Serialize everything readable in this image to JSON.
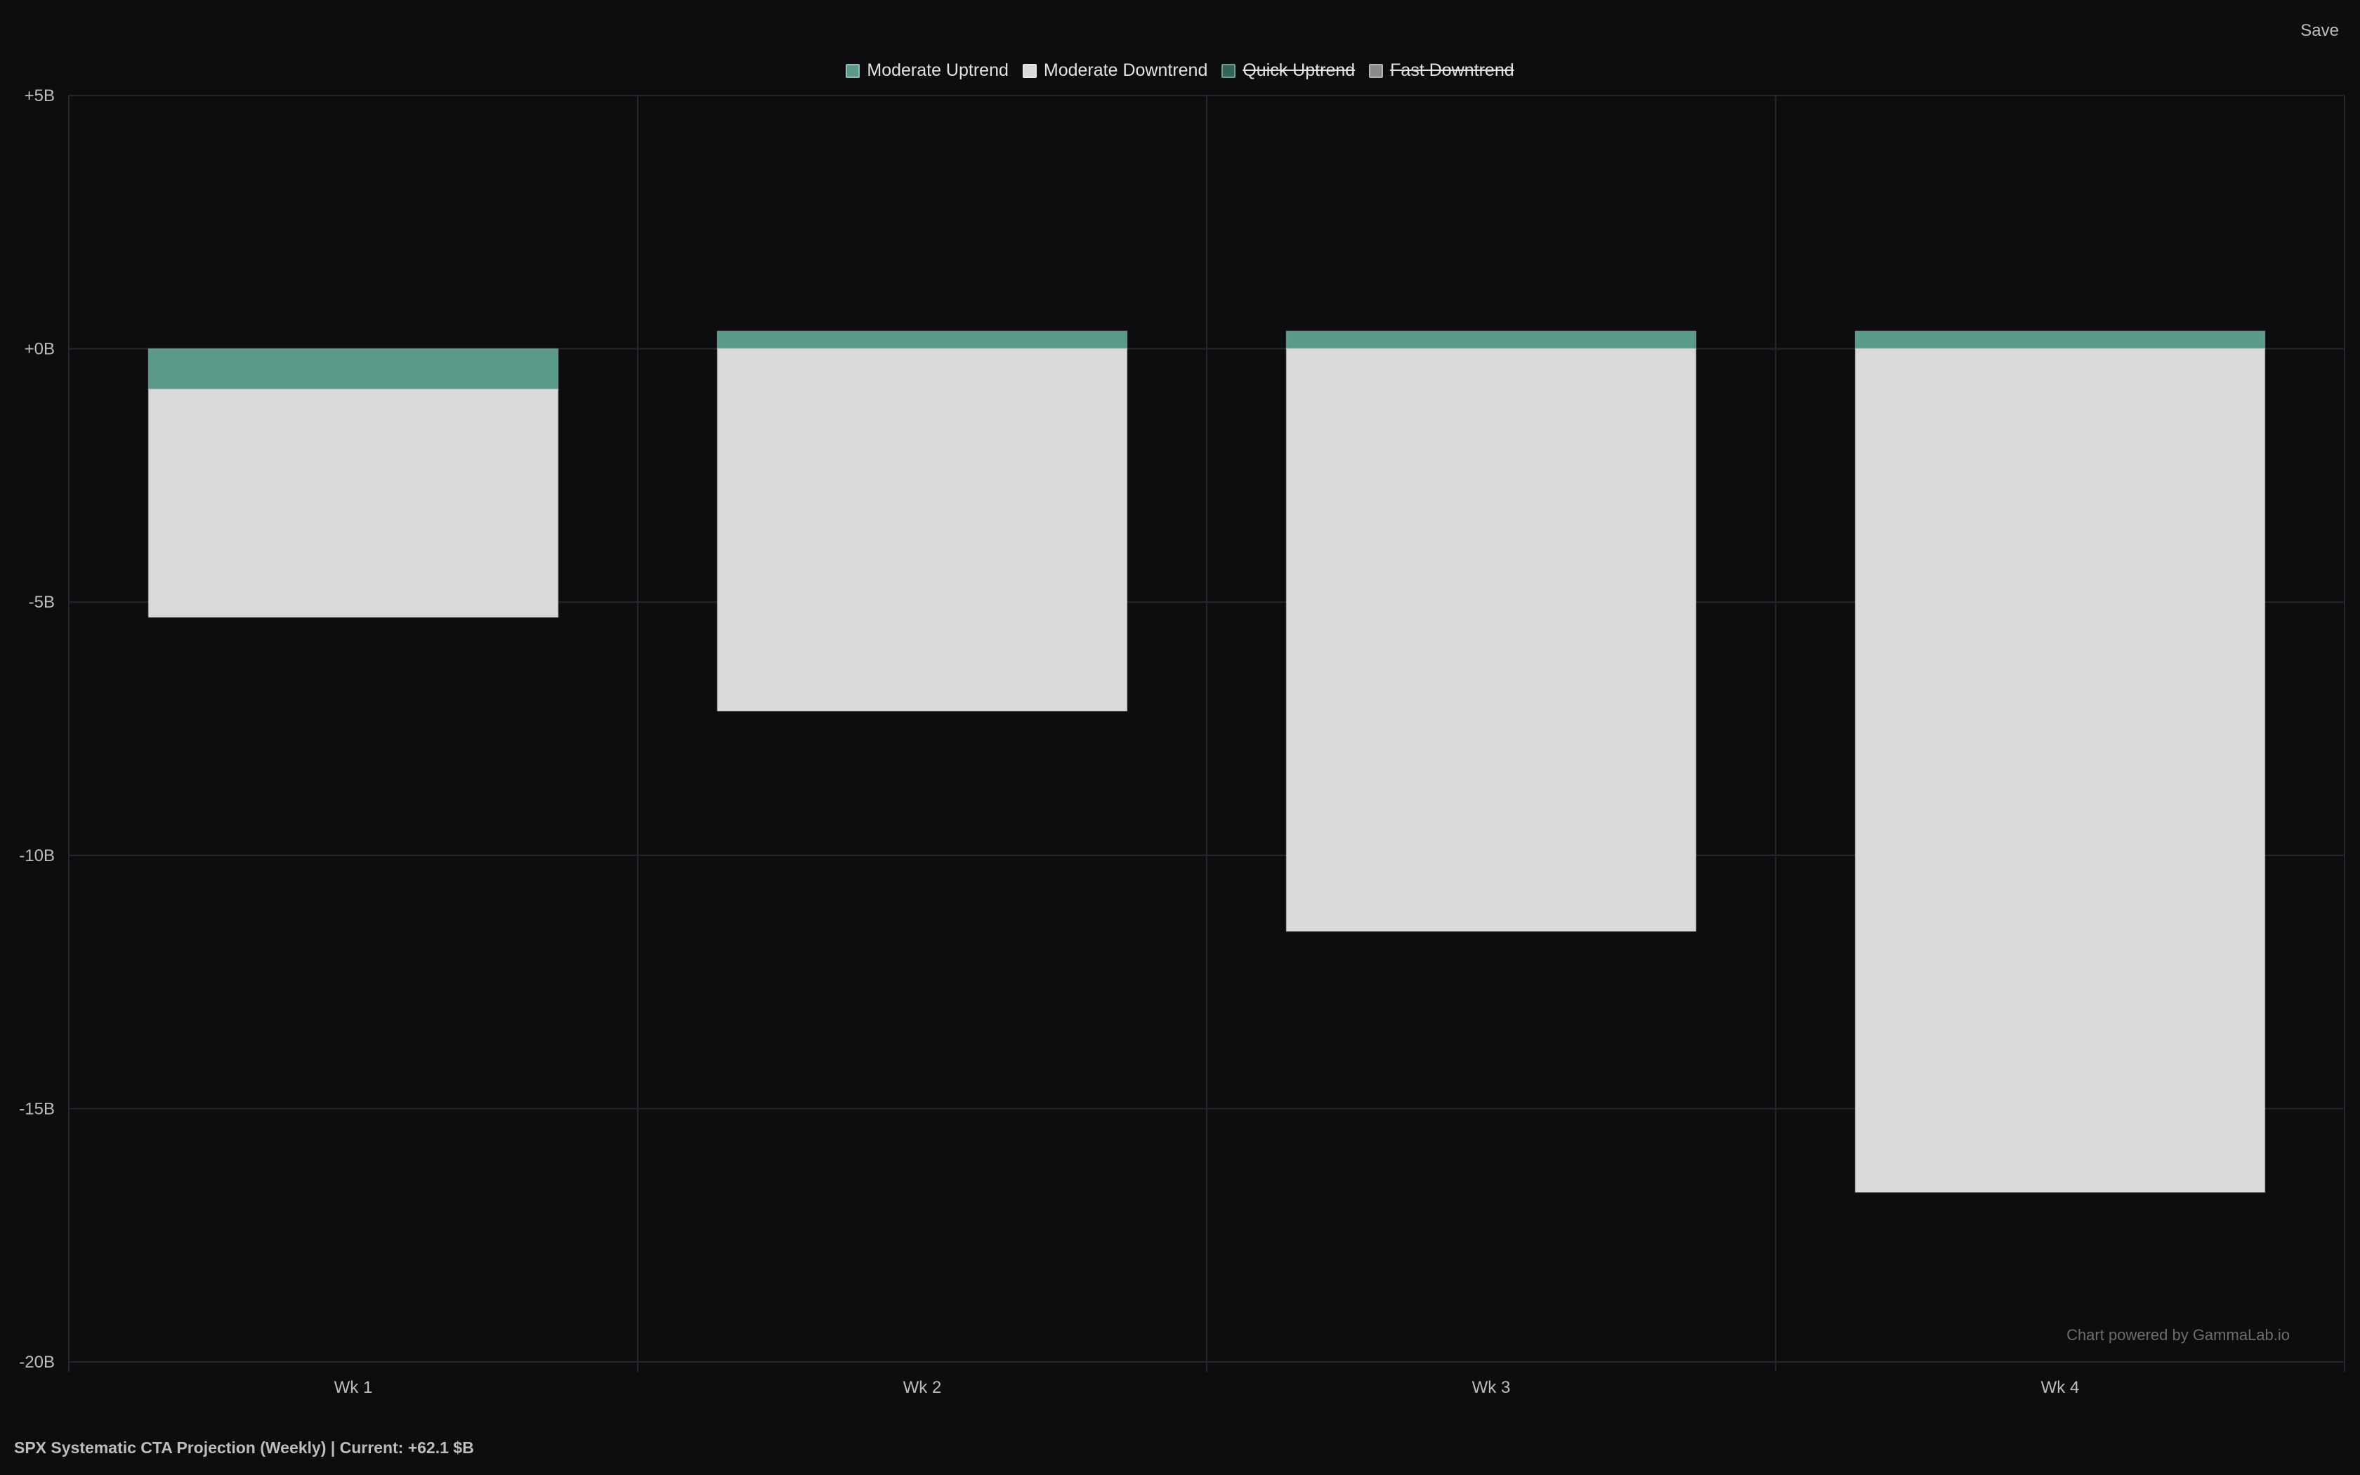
{
  "save_label": "Save",
  "footer_title": "SPX Systematic CTA Projection (Weekly) | Current: +62.1 $B",
  "watermark": "Chart powered by GammaLab.io",
  "legend": [
    {
      "label": "Moderate Uptrend",
      "color": "#5a9a8a",
      "hidden": false
    },
    {
      "label": "Moderate Downtrend",
      "color": "#d9d9d9",
      "hidden": false
    },
    {
      "label": "Quick Uptrend",
      "color": "#2f6657",
      "hidden": true
    },
    {
      "label": "Fast Downtrend",
      "color": "#8a8a8a",
      "hidden": true
    }
  ],
  "chart_data": {
    "type": "bar",
    "stacked": true,
    "categories": [
      "Wk 1",
      "Wk 2",
      "Wk 3",
      "Wk 4"
    ],
    "series": [
      {
        "name": "Moderate Uptrend",
        "values": [
          -0.8,
          0.35,
          0.35,
          0.35
        ],
        "color": "#5a9a8a"
      },
      {
        "name": "Moderate Downtrend",
        "values": [
          -4.5,
          -7.15,
          -11.5,
          -16.65
        ],
        "color": "#d9d9d9"
      }
    ],
    "ylim": [
      -20,
      5
    ],
    "yticks": [
      5,
      0,
      -5,
      -10,
      -15,
      -20
    ],
    "ytick_labels": [
      "+5B",
      "+0B",
      "-5B",
      "-10B",
      "-15B",
      "-20B"
    ],
    "grid": true,
    "legend_position": "top-center",
    "title": "",
    "xlabel": "",
    "ylabel": ""
  }
}
